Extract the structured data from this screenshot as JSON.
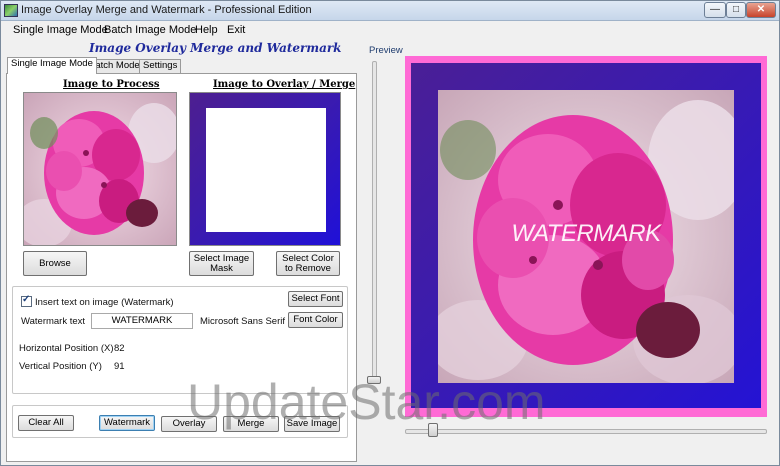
{
  "window": {
    "title": "Image Overlay Merge and Watermark - Professional Edition",
    "minimize_glyph": "—",
    "maximize_glyph": "□",
    "close_glyph": "✕"
  },
  "menu": [
    "Single Image Mode",
    "Batch Image Mode",
    "Help",
    "Exit"
  ],
  "heading": "Image Overlay Merge and Watermark",
  "tabs": [
    "Single Image Mode",
    "Batch Mode",
    "Settings"
  ],
  "single": {
    "image_to_process_label": "Image to Process",
    "image_to_overlay_label": "Image to Overlay / Merge",
    "browse_label": "Browse",
    "select_mask_label": "Select Image Mask",
    "select_color_label": "Select Color to Remove",
    "insert_text_label": "Insert text on image (Watermark)",
    "insert_text_checked": true,
    "select_font_label": "Select Font",
    "watermark_text_label": "Watermark text",
    "watermark_text_value": "WATERMARK",
    "font_name": "Microsoft Sans Serif",
    "font_color_label": "Font Color",
    "hpos_label": "Horizontal Position (X)",
    "hpos_value": "82",
    "vpos_label": "Vertical Position (Y)",
    "vpos_value": "91",
    "clear_all_label": "Clear All",
    "watermark_btn_label": "Watermark",
    "overlay_btn_label": "Overlay",
    "merge_btn_label": "Merge",
    "save_image_label": "Save Image"
  },
  "preview": {
    "label": "Preview",
    "watermark_text": "WATERMARK",
    "frame_color": "#ff6ad5",
    "overlay_color": "#2a16c8"
  },
  "site_watermark": "UpdateStar.com"
}
